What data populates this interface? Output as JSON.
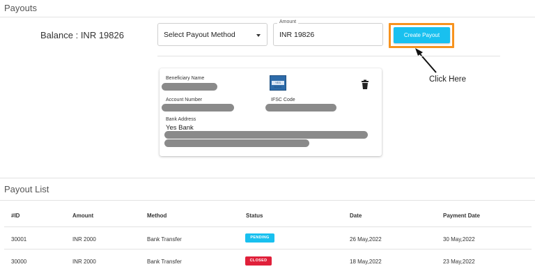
{
  "payouts": {
    "title": "Payouts",
    "balance": "Balance : INR 19826",
    "method_select": "Select Payout Method",
    "amount_legend": "Amount",
    "amount_value": "INR  19826",
    "create_button": "Create Payout",
    "annotation": "Click Here",
    "highlight_color": "#f7931e",
    "button_color": "#19c0ef"
  },
  "beneficiary_card": {
    "beneficiary_name_label": "Beneficiary Name",
    "account_number_label": "Account Number",
    "ifsc_label": "IFSC Code",
    "bank_address_label": "Bank Address",
    "bank_name": "Yes Bank",
    "bank_logo_text": "YES BANK",
    "delete_icon": "trash-icon"
  },
  "payout_list": {
    "title": "Payout List",
    "columns": [
      "#ID",
      "Amount",
      "Method",
      "Status",
      "Date",
      "Payment Date"
    ],
    "rows": [
      {
        "id": "30001",
        "amount": "INR 2000",
        "method": "Bank Transfer",
        "status": "PENDING",
        "status_color": "#19c0ef",
        "date": "26 May,2022",
        "payment_date": "30 May,2022"
      },
      {
        "id": "30000",
        "amount": "INR 2000",
        "method": "Bank Transfer",
        "status": "CLOSED",
        "status_color": "#e0203a",
        "date": "18 May,2022",
        "payment_date": "23 May,2022"
      }
    ]
  }
}
